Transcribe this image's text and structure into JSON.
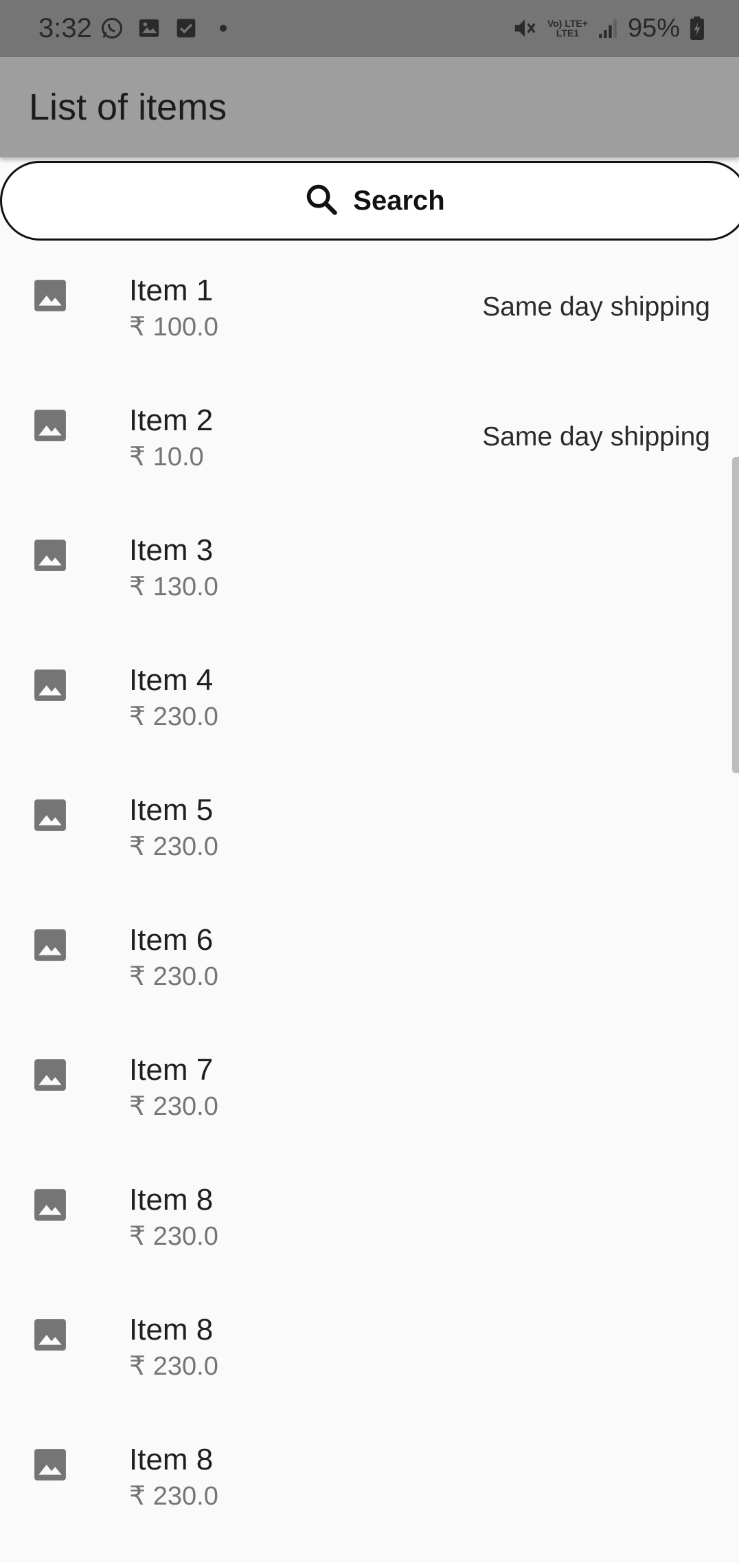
{
  "status_bar": {
    "time": "3:32",
    "left_icons": [
      "whatsapp-icon",
      "gallery-icon",
      "checkbox-icon",
      "dot-icon"
    ],
    "network_label_top": "Vo) LTE+",
    "network_label_bottom": "LTE1",
    "battery_percent": "95%"
  },
  "app_bar": {
    "title": "List of items",
    "background": "#9e9e9e"
  },
  "search": {
    "label": "Search"
  },
  "items": [
    {
      "name": "Item 1",
      "price": "₹ 100.0",
      "shipping": "Same day shipping"
    },
    {
      "name": "Item 2",
      "price": "₹ 10.0",
      "shipping": "Same day shipping"
    },
    {
      "name": "Item 3",
      "price": "₹ 130.0",
      "shipping": ""
    },
    {
      "name": "Item 4",
      "price": "₹ 230.0",
      "shipping": ""
    },
    {
      "name": "Item 5",
      "price": "₹ 230.0",
      "shipping": ""
    },
    {
      "name": "Item 6",
      "price": "₹ 230.0",
      "shipping": ""
    },
    {
      "name": "Item 7",
      "price": "₹ 230.0",
      "shipping": ""
    },
    {
      "name": "Item 8",
      "price": "₹ 230.0",
      "shipping": ""
    },
    {
      "name": "Item 8",
      "price": "₹ 230.0",
      "shipping": ""
    },
    {
      "name": "Item 8",
      "price": "₹ 230.0",
      "shipping": ""
    }
  ]
}
